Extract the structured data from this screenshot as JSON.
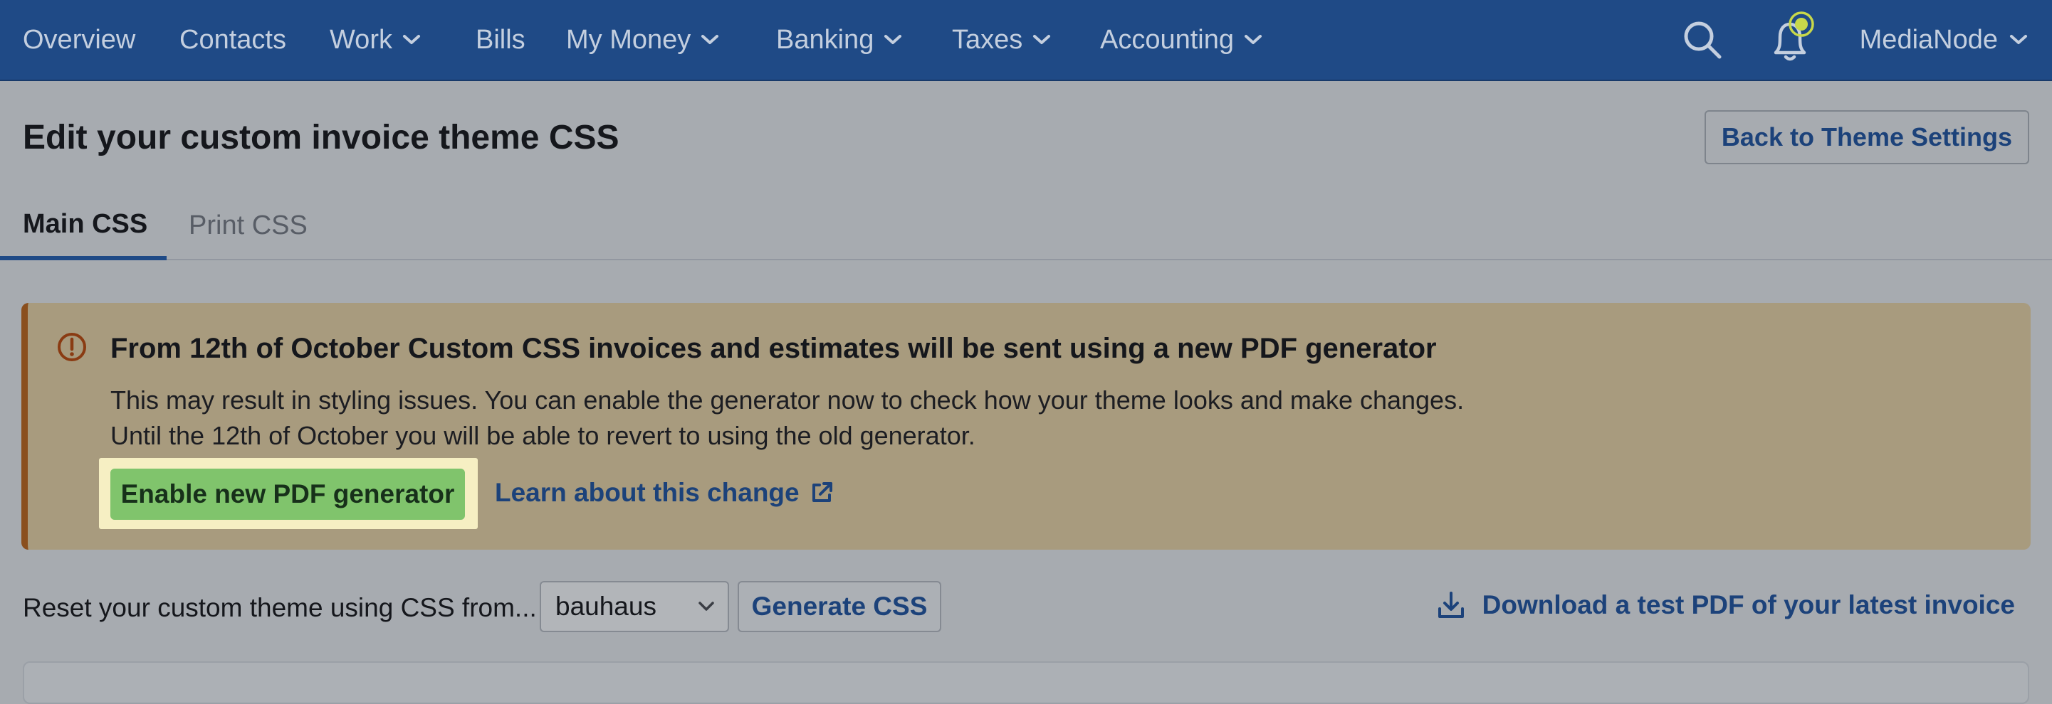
{
  "nav": {
    "items": [
      {
        "label": "Overview",
        "has_dropdown": false
      },
      {
        "label": "Contacts",
        "has_dropdown": false
      },
      {
        "label": "Work",
        "has_dropdown": true
      },
      {
        "label": "Bills",
        "has_dropdown": false
      },
      {
        "label": "My Money",
        "has_dropdown": true
      },
      {
        "label": "Banking",
        "has_dropdown": true
      },
      {
        "label": "Taxes",
        "has_dropdown": true
      },
      {
        "label": "Accounting",
        "has_dropdown": true
      }
    ],
    "search_icon": "search-icon",
    "notification_icon": "bell-icon",
    "account_label": "MediaNode",
    "colors": {
      "background": "#1f4a86",
      "text": "#c4cfdf",
      "notification_dot": "#c8d84a"
    }
  },
  "page": {
    "title": "Edit your custom invoice theme CSS",
    "back_button_label": "Back to Theme Settings"
  },
  "tabs": [
    {
      "label": "Main CSS",
      "active": true
    },
    {
      "label": "Print CSS",
      "active": false
    }
  ],
  "alert": {
    "icon": "alert-circle-icon",
    "title": "From 12th of October Custom CSS invoices and estimates will be sent using a new PDF generator",
    "body": "This may result in styling issues. You can enable the generator now to check how your theme looks and make changes. Until the 12th of October you will be able to revert to using the old generator.",
    "enable_button_label": "Enable new PDF generator",
    "learn_link_label": "Learn about this change",
    "colors": {
      "background": "#a89b7e",
      "accent": "#8a4f1e",
      "button": "#80c46c",
      "highlight": "#f6efc3"
    }
  },
  "reset": {
    "label": "Reset your custom theme using CSS from...",
    "selected_theme": "bauhaus",
    "generate_button_label": "Generate CSS",
    "download_link_label": "Download a test PDF of your latest invoice"
  }
}
